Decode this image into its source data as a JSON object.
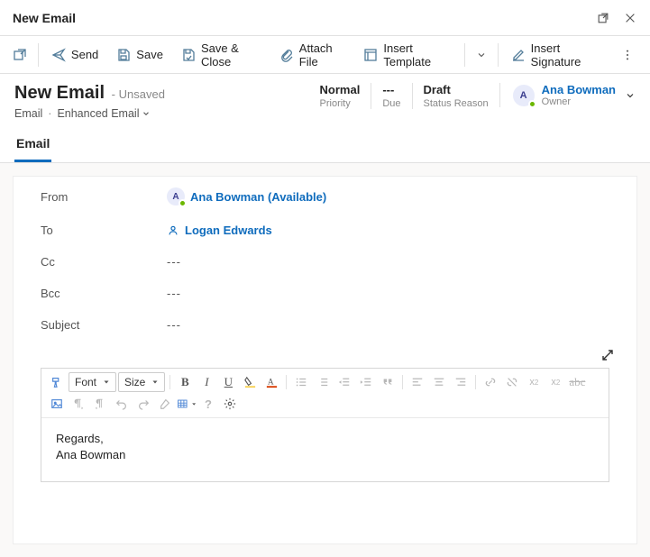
{
  "title": "New Email",
  "cmdbar": {
    "send": "Send",
    "save": "Save",
    "save_close": "Save & Close",
    "attach": "Attach File",
    "insert_template": "Insert Template",
    "insert_signature": "Insert Signature"
  },
  "header": {
    "h1": "New Email",
    "state": "- Unsaved",
    "crumb_entity": "Email",
    "crumb_form": "Enhanced Email",
    "meta": [
      {
        "value": "Normal",
        "label": "Priority"
      },
      {
        "value": "---",
        "label": "Due"
      },
      {
        "value": "Draft",
        "label": "Status Reason"
      }
    ],
    "owner_name": "Ana Bowman",
    "owner_label": "Owner",
    "owner_initial": "A"
  },
  "tab_email": "Email",
  "fields": {
    "from_lbl": "From",
    "from_val": "Ana Bowman (Available)",
    "from_initial": "A",
    "to_lbl": "To",
    "to_val": "Logan Edwards",
    "cc_lbl": "Cc",
    "cc_val": "---",
    "bcc_lbl": "Bcc",
    "bcc_val": "---",
    "subject_lbl": "Subject",
    "subject_val": "---"
  },
  "editor": {
    "font_label": "Font",
    "size_label": "Size",
    "body_line1": "Regards,",
    "body_line2": "Ana Bowman"
  }
}
